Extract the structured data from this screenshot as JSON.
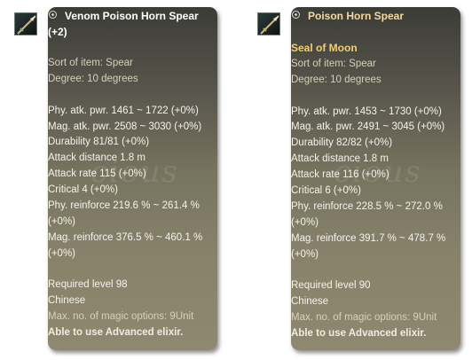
{
  "left": {
    "title_line1": "Venom Poison Horn Spear",
    "title_line2": "(+2)",
    "sort_of_item": "Sort of item: Spear",
    "degree": "Degree: 10 degrees",
    "stats": [
      "Phy. atk. pwr. 1461 ~ 1722 (+0%)",
      "Mag. atk. pwr. 2508 ~ 3030 (+0%)",
      "Durability 81/81 (+0%)",
      "Attack distance 1.8 m",
      "Attack rate 115 (+0%)",
      "Critical 4 (+0%)",
      "Phy.  reinforce 219.6 % ~ 261.4 %",
      "(+0%)",
      "Mag. reinforce 376.5 % ~ 460.1 %",
      "(+0%)"
    ],
    "required_level": "Required level 98",
    "race": "Chinese",
    "magic_options": "Max. no. of magic options: 9Unit",
    "advanced_elixir": "Able to use Advanced elixir.",
    "watermark": "cious"
  },
  "right": {
    "title": "Poison Horn Spear",
    "seal": "Seal of Moon",
    "sort_of_item": "Sort of item: Spear",
    "degree": "Degree: 10 degrees",
    "stats": [
      "Phy. atk. pwr. 1453 ~ 1730 (+0%)",
      "Mag. atk. pwr. 2491 ~ 3045 (+0%)",
      "Durability 82/82 (+0%)",
      "Attack distance 1.8 m",
      "Attack rate 116 (+0%)",
      "Critical 6 (+0%)",
      "Phy.  reinforce 228.5 % ~ 272.0 %",
      "(+0%)",
      "Mag. reinforce 391.7 % ~ 478.7 %",
      "(+0%)"
    ],
    "required_level": "Required level 90",
    "race": "Chinese",
    "magic_options": "Max. no. of magic options: 9Unit",
    "advanced_elixir": "Able to use Advanced elixir.",
    "watermark": "cious"
  },
  "icons": {
    "left": "spear-item-icon",
    "right": "spear-item-icon"
  }
}
